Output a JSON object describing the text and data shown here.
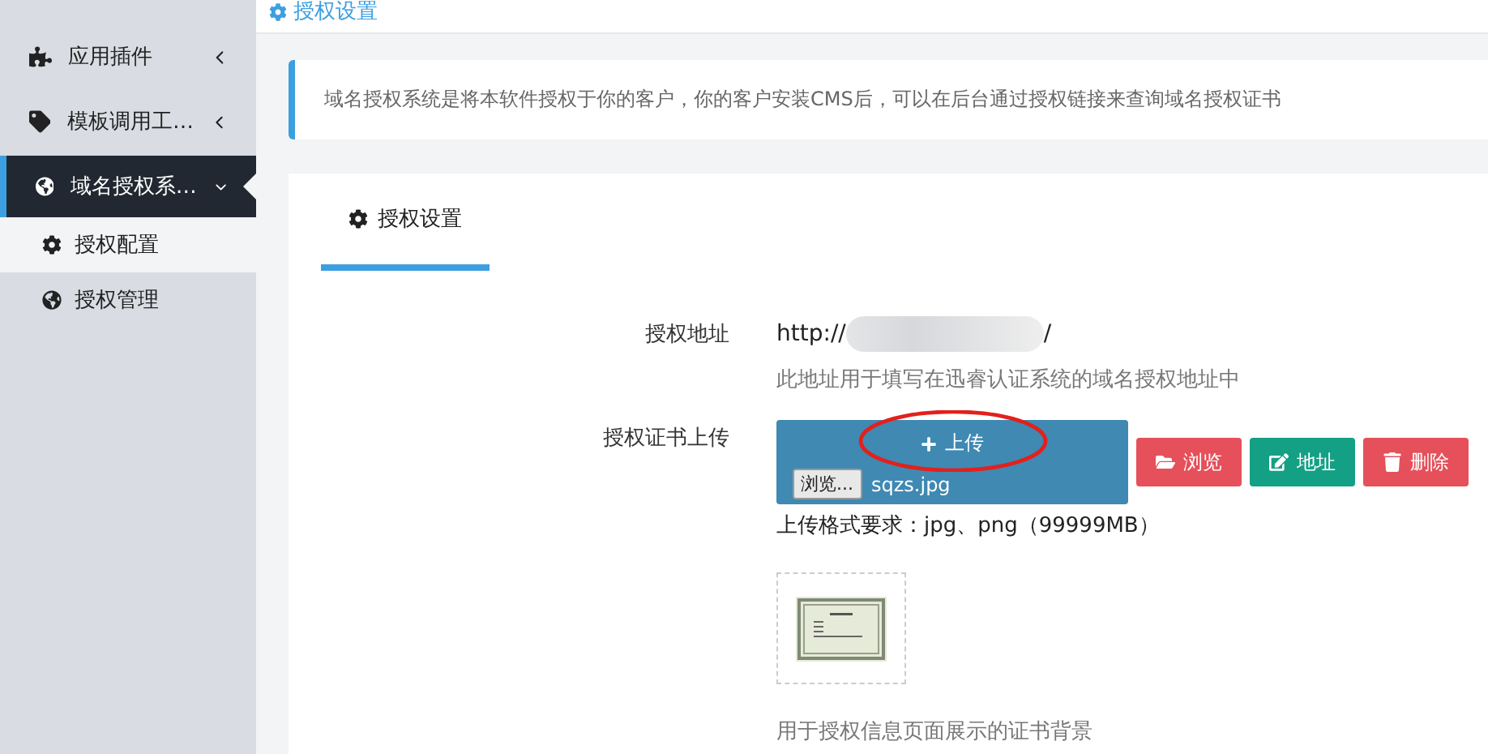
{
  "sidebar": {
    "items": [
      {
        "label": "应用插件",
        "expanded": false,
        "selected": false
      },
      {
        "label": "模板调用工…",
        "expanded": false,
        "selected": false
      },
      {
        "label": "域名授权系…",
        "expanded": true,
        "selected": true,
        "children": [
          {
            "label": "授权配置",
            "selected": true
          },
          {
            "label": "授权管理",
            "selected": false
          }
        ]
      }
    ]
  },
  "breadcrumb": "授权设置",
  "notice": "域名授权系统是将本软件授权于你的客户，你的客户安装CMS后，可以在后台通过授权链接来查询域名授权证书",
  "tabs": [
    {
      "label": "授权设置",
      "selected": true
    }
  ],
  "form": {
    "address_label": "授权地址",
    "address_value": "http://",
    "address_end": "/",
    "address_hint": "此地址用于填写在迅睿认证系统的域名授权地址中",
    "upload_label": "授权证书上传",
    "upload_button": "上传",
    "file_button": "浏览...",
    "file_name": "sqzs.jpg",
    "actions": [
      {
        "label": "浏览",
        "kind": "browse"
      },
      {
        "label": "地址",
        "kind": "address"
      },
      {
        "label": "删除",
        "kind": "delete"
      }
    ],
    "format_note": "上传格式要求：jpg、png（99999MB）",
    "image_hint": "用于授权信息页面展示的证书背景"
  }
}
